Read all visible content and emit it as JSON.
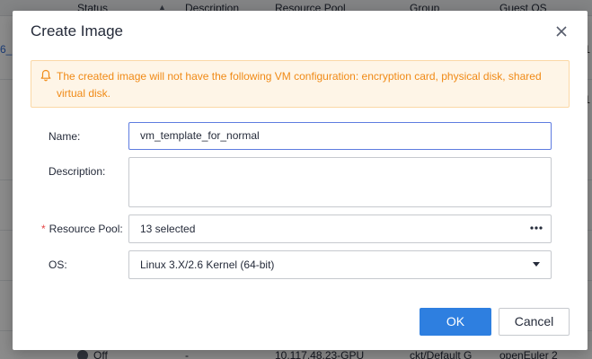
{
  "background_table": {
    "columns": [
      {
        "label": "Status",
        "sort_icon": "sort-up-icon"
      },
      {
        "label": "Description"
      },
      {
        "label": "Resource Pool"
      },
      {
        "label": "Group"
      },
      {
        "label": "Guest OS"
      }
    ],
    "left_fragment": "6_",
    "right_fragments": [
      "1",
      "1"
    ],
    "last_row": {
      "status": "Off",
      "description": "-",
      "resource_pool": "10.117.48.23-GPU",
      "group": "ckt/Default G",
      "guest_os": "openEuler 2"
    }
  },
  "dialog": {
    "title": "Create Image",
    "alert_text": "The created image will not have the following VM configuration: encryption card, physical disk, shared virtual disk.",
    "fields": {
      "name": {
        "label": "Name:",
        "value": "vm_template_for_normal"
      },
      "description": {
        "label": "Description:",
        "value": ""
      },
      "resource_pool": {
        "label": "Resource Pool:",
        "required_mark": "*",
        "value": "13 selected"
      },
      "os": {
        "label": "OS:",
        "value": "Linux 3.X/2.6 Kernel (64-bit)"
      }
    },
    "buttons": {
      "ok": "OK",
      "cancel": "Cancel"
    }
  },
  "colors": {
    "primary": "#2e7fe0",
    "alert_text": "#f08a16",
    "alert_bg": "#fef5e7",
    "required": "#e54545"
  }
}
